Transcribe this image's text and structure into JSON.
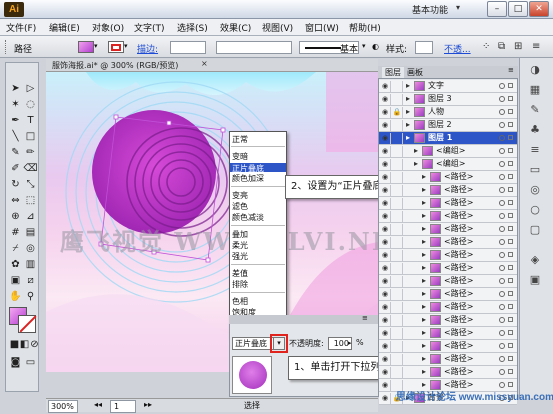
{
  "window": {
    "app_icon": "Ai",
    "workspace": "基本功能",
    "min": "–",
    "max": "□",
    "close": "✕"
  },
  "menu": [
    "文件(F)",
    "编辑(E)",
    "对象(O)",
    "文字(T)",
    "选择(S)",
    "效果(C)",
    "视图(V)",
    "窗口(W)",
    "帮助(H)"
  ],
  "control": {
    "label": "路径",
    "stroke_link": "描边:",
    "basic": "基本",
    "style_label": "样式:",
    "opacity_link": "不透..."
  },
  "document": {
    "tab": "服饰海报.ai* @ 300% (RGB/预览)",
    "zoom": "300%",
    "page": "1",
    "status_label": "选择"
  },
  "dropdown": {
    "groups": [
      [
        "正常"
      ],
      [
        "变暗",
        "正片叠底",
        "颜色加深"
      ],
      [
        "变亮",
        "滤色",
        "颜色减淡"
      ],
      [
        "叠加",
        "柔光",
        "强光"
      ],
      [
        "差值",
        "排除"
      ],
      [
        "色相",
        "饱和度",
        "混色",
        "明度"
      ]
    ],
    "selected": "正片叠底"
  },
  "transparency": {
    "mode": "正片叠底",
    "opacity_label": "不透明度:",
    "opacity": "100",
    "unit": "%"
  },
  "layers": {
    "tabs": [
      "图层",
      "画板"
    ],
    "rows": [
      {
        "name": "文字",
        "locked": false,
        "indent": 0
      },
      {
        "name": "图层 3",
        "locked": false,
        "indent": 0
      },
      {
        "name": "人物",
        "locked": true,
        "indent": 0
      },
      {
        "name": "图层 2",
        "locked": false,
        "indent": 0
      },
      {
        "name": "图层 1",
        "locked": false,
        "indent": 0,
        "active": true
      },
      {
        "name": "<编组>",
        "locked": false,
        "indent": 1
      },
      {
        "name": "<编组>",
        "locked": false,
        "indent": 1
      },
      {
        "name": "<路径>",
        "locked": false,
        "indent": 2
      },
      {
        "name": "<路径>",
        "locked": false,
        "indent": 2
      },
      {
        "name": "<路径>",
        "locked": false,
        "indent": 2
      },
      {
        "name": "<路径>",
        "locked": false,
        "indent": 2
      },
      {
        "name": "<路径>",
        "locked": false,
        "indent": 2
      },
      {
        "name": "<路径>",
        "locked": false,
        "indent": 2
      },
      {
        "name": "<路径>",
        "locked": false,
        "indent": 2
      },
      {
        "name": "<路径>",
        "locked": false,
        "indent": 2
      },
      {
        "name": "<路径>",
        "locked": false,
        "indent": 2
      },
      {
        "name": "<路径>",
        "locked": false,
        "indent": 2
      },
      {
        "name": "<路径>",
        "locked": false,
        "indent": 2
      },
      {
        "name": "<路径>",
        "locked": false,
        "indent": 2
      },
      {
        "name": "<路径>",
        "locked": false,
        "indent": 2
      },
      {
        "name": "<路径>",
        "locked": false,
        "indent": 2
      },
      {
        "name": "<路径>",
        "locked": false,
        "indent": 2
      },
      {
        "name": "<路径>",
        "locked": false,
        "indent": 2
      },
      {
        "name": "<路径>",
        "locked": false,
        "indent": 2
      },
      {
        "name": "背景",
        "locked": true,
        "indent": 0
      }
    ]
  },
  "callouts": {
    "step2": "2、设置为“正片叠底”模式",
    "step1": "1、单击打开下拉列表"
  },
  "watermark": "鹰飞视觉 WWW.TLVI.NE",
  "site_logo": "思缘设计论坛 www.missyuan.com",
  "colors": {
    "fill": "#c040d0",
    "accent_red": "#e0231c",
    "highlight": "#2d55c8"
  }
}
